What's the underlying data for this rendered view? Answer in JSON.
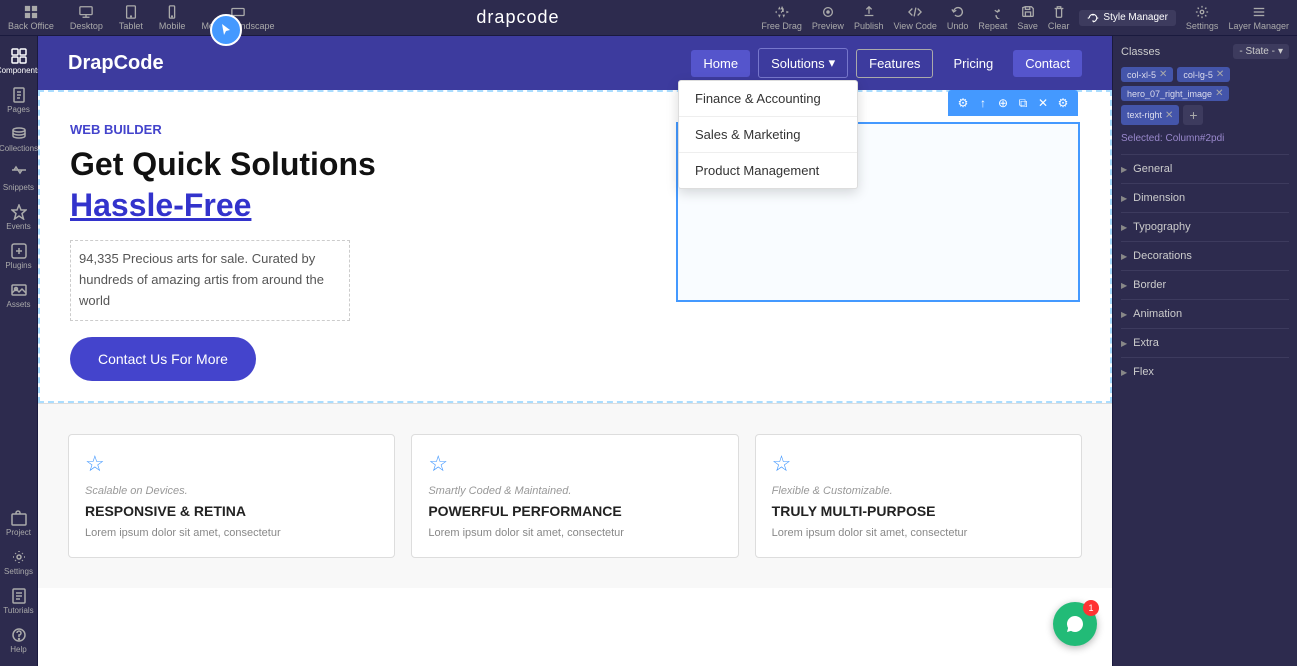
{
  "app": {
    "name": "drapcode",
    "title": "drapcode"
  },
  "toolbar": {
    "devices": [
      {
        "label": "Back Office",
        "icon": "home"
      },
      {
        "label": "Desktop",
        "icon": "monitor"
      },
      {
        "label": "Tablet",
        "icon": "tablet"
      },
      {
        "label": "Mobile",
        "icon": "mobile"
      },
      {
        "label": "Mobile Landscape",
        "icon": "mobile-landscape"
      }
    ],
    "actions": [
      {
        "label": "Free Drag",
        "icon": "move"
      },
      {
        "label": "Preview",
        "icon": "eye"
      },
      {
        "label": "Publish",
        "icon": "upload"
      },
      {
        "label": "View Code",
        "icon": "code"
      },
      {
        "label": "Undo",
        "icon": "undo"
      },
      {
        "label": "Repeat",
        "icon": "repeat"
      },
      {
        "label": "Save",
        "icon": "save"
      },
      {
        "label": "Clear",
        "icon": "trash"
      }
    ],
    "style_manager": "Style Manager",
    "settings": "Settings",
    "layer_manager": "Layer Manager"
  },
  "left_sidebar": {
    "items": [
      {
        "label": "Components",
        "icon": "grid"
      },
      {
        "label": "Pages",
        "icon": "file"
      },
      {
        "label": "Collections",
        "icon": "layers"
      },
      {
        "label": "Snippets",
        "icon": "scissors"
      },
      {
        "label": "Events",
        "icon": "bolt"
      },
      {
        "label": "Plugins",
        "icon": "puzzle"
      },
      {
        "label": "Assets",
        "icon": "image"
      },
      {
        "label": "Project",
        "icon": "briefcase"
      },
      {
        "label": "Settings",
        "icon": "gear"
      },
      {
        "label": "Tutorials",
        "icon": "book"
      },
      {
        "label": "Help",
        "icon": "question"
      }
    ]
  },
  "preview": {
    "navbar": {
      "brand": "DrapCode",
      "links": [
        {
          "label": "Home",
          "active": true
        },
        {
          "label": "Solutions",
          "has_dropdown": true,
          "active": false
        },
        {
          "label": "Features",
          "active": false
        },
        {
          "label": "Pricing",
          "active": false
        },
        {
          "label": "Contact",
          "active": false
        }
      ],
      "dropdown": {
        "items": [
          {
            "label": "Finance & Accounting"
          },
          {
            "label": "Sales & Marketing"
          },
          {
            "label": "Product Management"
          }
        ]
      }
    },
    "hero": {
      "web_builder_label": "WEB BUILDER",
      "title": "Get Quick Solutions",
      "subtitle": "Hassle-Free",
      "description": "94,335 Precious arts for sale. Curated by hundreds of amazing artis from around the world",
      "cta_button": "Contact Us For More"
    },
    "features": [
      {
        "label": "Scalable on Devices.",
        "title": "RESPONSIVE & RETINA",
        "description": "Lorem ipsum dolor sit amet, consectetur"
      },
      {
        "label": "Smartly Coded & Maintained.",
        "title": "POWERFUL PERFORMANCE",
        "description": "Lorem ipsum dolor sit amet, consectetur"
      },
      {
        "label": "Flexible & Customizable.",
        "title": "TRULY MULTI-PURPOSE",
        "description": "Lorem ipsum dolor sit amet, consectetur"
      }
    ]
  },
  "right_sidebar": {
    "classes_label": "Classes",
    "state_label": "- State -",
    "class_tags": [
      {
        "label": "col-xl-5"
      },
      {
        "label": "col-lg-5"
      },
      {
        "label": "hero_07_right_image"
      },
      {
        "label": "text-right"
      }
    ],
    "selected_label": "Selected: Column#2pdi",
    "sections": [
      {
        "label": "General",
        "expanded": false
      },
      {
        "label": "Dimension",
        "expanded": false
      },
      {
        "label": "Typography",
        "expanded": false
      },
      {
        "label": "Decorations",
        "expanded": false
      },
      {
        "label": "Border",
        "expanded": false
      },
      {
        "label": "Animation",
        "expanded": false
      },
      {
        "label": "Extra",
        "expanded": false
      },
      {
        "label": "Flex",
        "expanded": false
      }
    ]
  },
  "chat": {
    "badge_count": "1"
  }
}
